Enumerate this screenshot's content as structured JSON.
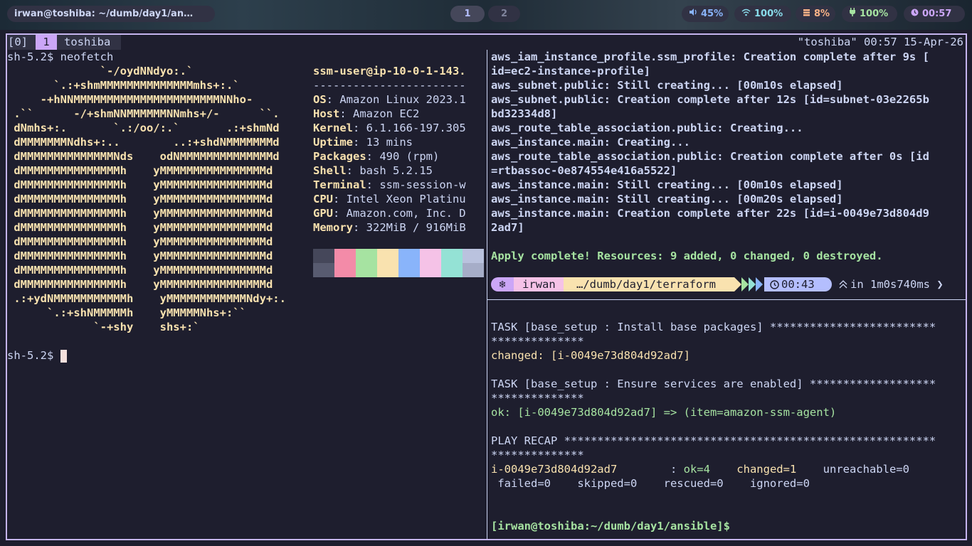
{
  "topbar": {
    "window_title": "irwan@toshiba: ~/dumb/day1/an…",
    "workspaces": [
      "1",
      "2"
    ],
    "volume": "45%",
    "wifi": "100%",
    "memory": "8%",
    "battery": "100%",
    "clock": "00:57",
    "icons": {
      "volume": "speaker-icon",
      "wifi": "wifi-icon",
      "memory": "memory-icon",
      "battery": "plug-icon",
      "clock": "clock-icon"
    }
  },
  "tmux": {
    "session": "[0]",
    "window_index": "1",
    "window_name": "toshiba",
    "right_status": "\"toshiba\" 00:57 15-Apr-26"
  },
  "left": {
    "prompt": "sh-5.2$ neofetch",
    "logo": [
      "              `-/oydNNdyo:.`",
      "       `.:+shmMMMMMMMMMMMMMMmhs+:.`",
      "     -+hNNMMMMMMMMMMMMMMMMMMMMMMNNho-",
      " .``      -/+shmNNMMMMMMNNmhs+/-      ``.",
      " dNmhs+:.       `.:/oo/:.`       .:+shmNd",
      " dMMMMMMMNdhs+:..        ..:+shdNMMMMMMMd",
      " dMMMMMMMMMMMMMMNds    odNMMMMMMMMMMMMMMd",
      " dMMMMMMMMMMMMMMMh    yMMMMMMMMMMMMMMMMd",
      " dMMMMMMMMMMMMMMMh    yMMMMMMMMMMMMMMMMd",
      " dMMMMMMMMMMMMMMMh    yMMMMMMMMMMMMMMMMd",
      " dMMMMMMMMMMMMMMMh    yMMMMMMMMMMMMMMMMd",
      " dMMMMMMMMMMMMMMMh    yMMMMMMMMMMMMMMMMd",
      " dMMMMMMMMMMMMMMMh    yMMMMMMMMMMMMMMMMd",
      " dMMMMMMMMMMMMMMMh    yMMMMMMMMMMMMMMMMd",
      " dMMMMMMMMMMMMMMMh    yMMMMMMMMMMMMMMMMd",
      " dMMMMMMMMMMMMMMMh    yMMMMMMMMMMMMMMMMd",
      " .:+ydNMMMMMMMMMMMh    yMMMMMMMMMMMMNdy+:.",
      "      `.:+shNMMMMMh    yMMMMMNhs+:``",
      "             `-+shy    shs+:`"
    ],
    "info_header": "ssm-user@ip-10-0-1-143.",
    "info_sep": "-----------------------",
    "info": [
      {
        "k": "OS",
        "v": "Amazon Linux 2023.1"
      },
      {
        "k": "Host",
        "v": "Amazon EC2"
      },
      {
        "k": "Kernel",
        "v": "6.1.166-197.305"
      },
      {
        "k": "Uptime",
        "v": "13 mins"
      },
      {
        "k": "Packages",
        "v": "490 (rpm)"
      },
      {
        "k": "Shell",
        "v": "bash 5.2.15"
      },
      {
        "k": "Terminal",
        "v": "ssm-session-w"
      },
      {
        "k": "CPU",
        "v": "Intel Xeon Platinu"
      },
      {
        "k": "GPU",
        "v": "Amazon.com, Inc. D"
      },
      {
        "k": "Memory",
        "v": "322MiB / 916MiB"
      }
    ],
    "palette_top": [
      "#45475a",
      "#f38ba8",
      "#a6e3a1",
      "#f9e2af",
      "#89b4fa",
      "#f5c2e7",
      "#94e2d5",
      "#bac2de"
    ],
    "palette_bottom": [
      "#585b70",
      "#f38ba8",
      "#a6e3a1",
      "#f9e2af",
      "#89b4fa",
      "#f5c2e7",
      "#94e2d5",
      "#a6adc8"
    ],
    "prompt2": "sh-5.2$ "
  },
  "right_top": {
    "lines": [
      "aws_iam_instance_profile.ssm_profile: Creation complete after 9s [",
      "id=ec2-instance-profile]",
      "aws_subnet.public: Still creating... [00m10s elapsed]",
      "aws_subnet.public: Creation complete after 12s [id=subnet-03e2265b",
      "bd32334d8]",
      "aws_route_table_association.public: Creating...",
      "aws_instance.main: Creating...",
      "aws_route_table_association.public: Creation complete after 0s [id",
      "=rtbassoc-0e874554e416a5522]",
      "aws_instance.main: Still creating... [00m10s elapsed]",
      "aws_instance.main: Still creating... [00m20s elapsed]",
      "aws_instance.main: Creation complete after 22s [id=i-0049e73d804d9",
      "2ad7]"
    ],
    "apply": "Apply complete! Resources: 9 added, 0 changed, 0 destroyed.",
    "prompt": {
      "os_icon": "❄",
      "user": "irwan",
      "dir": "…/dumb/day1/terraform",
      "time": "00:43",
      "duration": "in 1m0s740ms ❯"
    }
  },
  "right_bottom": {
    "task1": "TASK [base_setup : Install base packages] *************************",
    "task1b": "**************",
    "changed": "changed: [i-0049e73d804d92ad7]",
    "task2": "TASK [base_setup : Ensure services are enabled] *******************",
    "task2b": "**************",
    "ok": "ok: [i-0049e73d804d92ad7] => (item=amazon-ssm-agent)",
    "recap": "PLAY RECAP ********************************************************",
    "recapb": "**************",
    "host": "i-0049e73d804d92ad7",
    "colon": "        : ",
    "ok_count": "ok=4",
    "changed_count": "changed=1",
    "unreach": "unreachable=0",
    "rest": " failed=0    skipped=0    rescued=0    ignored=0",
    "final_prompt": "[irwan@toshiba:~/dumb/day1/ansible]$"
  }
}
